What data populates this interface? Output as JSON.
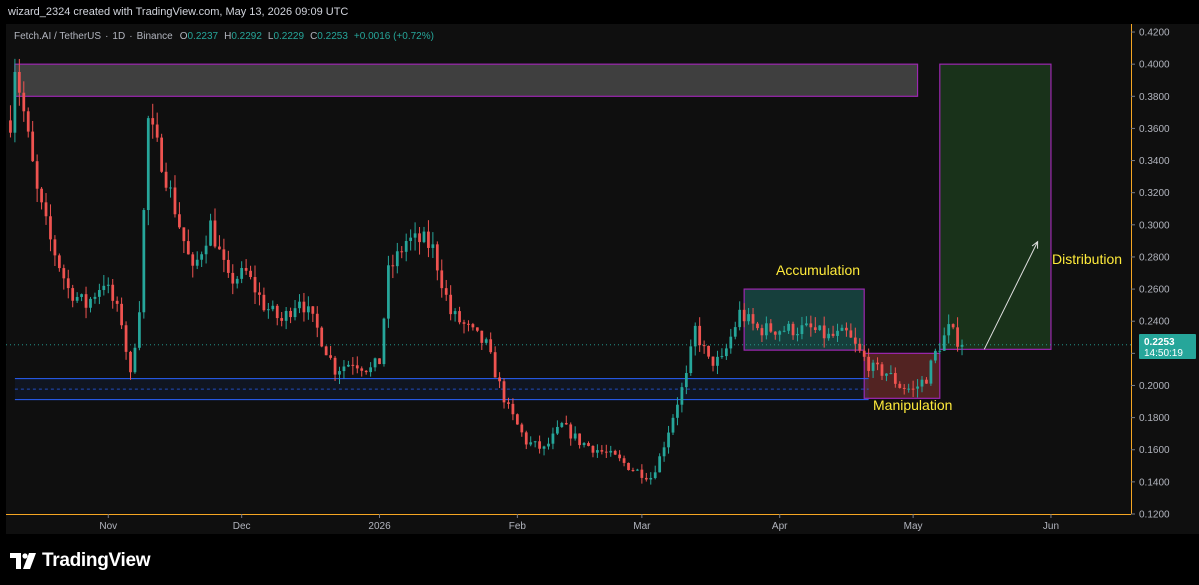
{
  "header": {
    "created_by": "wizard_2324 created with TradingView.com, May 13, 2026 09:09 UTC"
  },
  "symbol_info": {
    "name": "Fetch.AI / TetherUS",
    "interval": "1D",
    "exchange": "Binance",
    "open_label": "O",
    "open": "0.2237",
    "high_label": "H",
    "high": "0.2292",
    "low_label": "L",
    "low": "0.2229",
    "close_label": "C",
    "close": "0.2253",
    "change": "+0.0016 (+0.72%)"
  },
  "price_tag": {
    "price": "0.2253",
    "countdown": "14:50:19"
  },
  "annotations": {
    "accumulation": "Accumulation",
    "manipulation": "Manipulation",
    "distribution": "Distribution"
  },
  "footer": {
    "brand": "TradingView"
  },
  "colors": {
    "bull": "#26a69a",
    "bear": "#ef5350",
    "accent_label": "#ffeb3b",
    "box_border": "#9c27b0",
    "support_line": "#2962ff",
    "cursor_line": "#f7525f"
  },
  "chart_data": {
    "type": "candlestick",
    "title": "Fetch.AI / TetherUS · 1D · Binance",
    "ylim": [
      0.12,
      0.425
    ],
    "y_ticks": [
      "0.4200",
      "0.4000",
      "0.3800",
      "0.3600",
      "0.3400",
      "0.3200",
      "0.3000",
      "0.2800",
      "0.2600",
      "0.2400",
      "0.2200",
      "0.2000",
      "0.1800",
      "0.1600",
      "0.1400",
      "0.1200"
    ],
    "x_ticks": [
      {
        "label": "Nov",
        "date": "2025-11-01"
      },
      {
        "label": "Dec",
        "date": "2025-12-01"
      },
      {
        "label": "2026",
        "date": "2026-01-01"
      },
      {
        "label": "Feb",
        "date": "2026-02-01"
      },
      {
        "label": "Mar",
        "date": "2026-03-01"
      },
      {
        "label": "Apr",
        "date": "2026-04-01"
      },
      {
        "label": "May",
        "date": "2026-05-01"
      },
      {
        "label": "Jun",
        "date": "2026-06-01"
      }
    ],
    "x_range": [
      "2025-10-09",
      "2026-06-19"
    ],
    "series": [
      {
        "trend": [
          [
            "2025-10-10",
            0.365
          ],
          [
            "2025-10-11",
            0.4
          ],
          [
            "2025-10-13",
            0.37
          ],
          [
            "2025-10-16",
            0.32
          ],
          [
            "2025-10-19",
            0.29
          ],
          [
            "2025-10-23",
            0.26
          ],
          [
            "2025-10-27",
            0.25
          ],
          [
            "2025-10-31",
            0.265
          ],
          [
            "2025-11-04",
            0.24
          ],
          [
            "2025-11-06",
            0.205
          ],
          [
            "2025-11-08",
            0.25
          ],
          [
            "2025-11-10",
            0.365
          ],
          [
            "2025-11-13",
            0.34
          ],
          [
            "2025-11-17",
            0.3
          ],
          [
            "2025-11-20",
            0.27
          ],
          [
            "2025-11-24",
            0.3
          ],
          [
            "2025-11-28",
            0.265
          ],
          [
            "2025-12-02",
            0.27
          ],
          [
            "2025-12-06",
            0.25
          ],
          [
            "2025-12-10",
            0.24
          ],
          [
            "2025-12-14",
            0.255
          ],
          [
            "2025-12-18",
            0.235
          ],
          [
            "2025-12-22",
            0.21
          ],
          [
            "2025-12-26",
            0.215
          ],
          [
            "2025-12-30",
            0.21
          ],
          [
            "2026-01-01",
            0.215
          ],
          [
            "2026-01-03",
            0.27
          ],
          [
            "2026-01-07",
            0.29
          ],
          [
            "2026-01-11",
            0.29
          ],
          [
            "2026-01-13",
            0.285
          ],
          [
            "2026-01-17",
            0.245
          ],
          [
            "2026-01-21",
            0.235
          ],
          [
            "2026-01-25",
            0.225
          ],
          [
            "2026-01-28",
            0.2
          ],
          [
            "2026-01-30",
            0.185
          ],
          [
            "2026-02-03",
            0.165
          ],
          [
            "2026-02-07",
            0.16
          ],
          [
            "2026-02-11",
            0.175
          ],
          [
            "2026-02-15",
            0.165
          ],
          [
            "2026-02-19",
            0.16
          ],
          [
            "2026-02-23",
            0.155
          ],
          [
            "2026-02-27",
            0.148
          ],
          [
            "2026-03-03",
            0.143
          ],
          [
            "2026-03-05",
            0.155
          ],
          [
            "2026-03-09",
            0.19
          ],
          [
            "2026-03-11",
            0.205
          ],
          [
            "2026-03-13",
            0.235
          ],
          [
            "2026-03-16",
            0.215
          ],
          [
            "2026-03-19",
            0.215
          ],
          [
            "2026-03-23",
            0.245
          ],
          [
            "2026-03-27",
            0.235
          ],
          [
            "2026-03-31",
            0.235
          ],
          [
            "2026-04-04",
            0.235
          ],
          [
            "2026-04-08",
            0.235
          ],
          [
            "2026-04-12",
            0.23
          ],
          [
            "2026-04-16",
            0.232
          ],
          [
            "2026-04-19",
            0.22
          ],
          [
            "2026-04-22",
            0.21
          ],
          [
            "2026-04-25",
            0.208
          ],
          [
            "2026-04-28",
            0.2
          ],
          [
            "2026-05-01",
            0.197
          ],
          [
            "2026-05-04",
            0.205
          ],
          [
            "2026-05-06",
            0.22
          ],
          [
            "2026-05-09",
            0.235
          ],
          [
            "2026-05-12",
            0.2253
          ]
        ]
      }
    ],
    "zones": [
      {
        "name": "supply",
        "x0": "2025-10-11",
        "x1": "2026-05-02",
        "y0": 0.38,
        "y1": 0.4
      },
      {
        "name": "accumulation",
        "x0": "2026-03-24",
        "x1": "2026-04-20",
        "y0": 0.222,
        "y1": 0.26
      },
      {
        "name": "manipulation",
        "x0": "2026-04-20",
        "x1": "2026-05-07",
        "y0": 0.192,
        "y1": 0.22
      },
      {
        "name": "distribution",
        "x0": "2026-05-07",
        "x1": "2026-06-01",
        "y0": 0.2225,
        "y1": 0.4
      }
    ],
    "support_band": {
      "x0": "2025-10-11",
      "x1": "2026-04-21",
      "upper": 0.2043,
      "lower": 0.1912
    },
    "arrow": {
      "from": [
        "2026-05-17",
        0.2225
      ],
      "to": [
        "2026-05-29",
        0.2895
      ]
    },
    "current_price": 0.2253,
    "cursor_date": "2025-10-08"
  }
}
